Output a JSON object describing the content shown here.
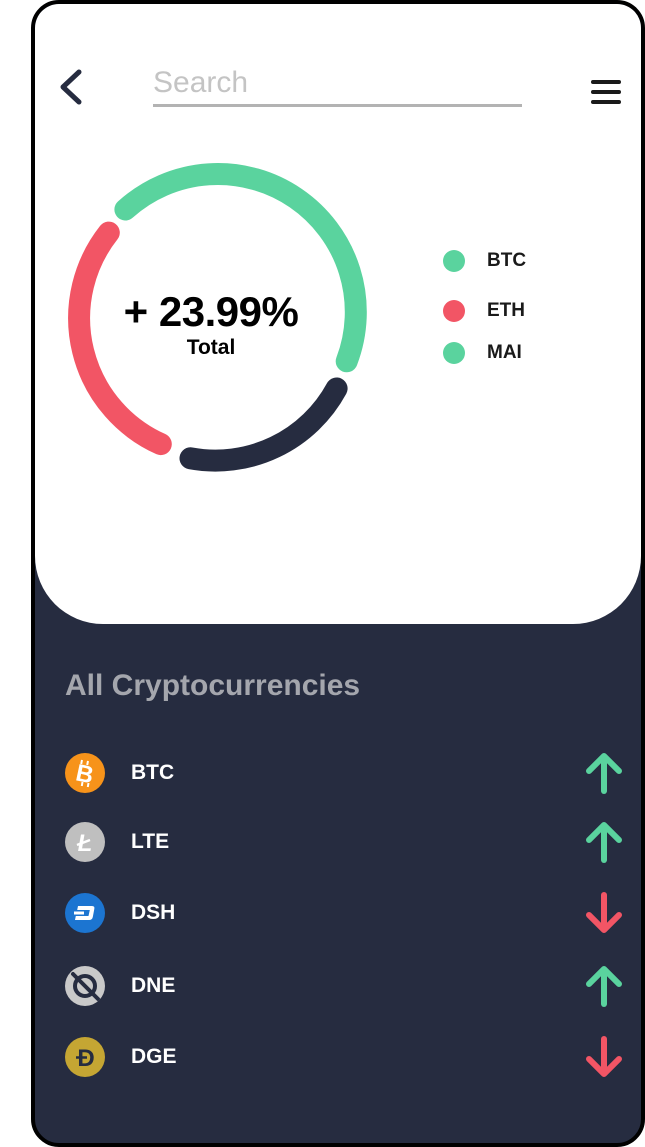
{
  "header": {
    "back_icon": "chevron-left-icon",
    "search_placeholder": "Search",
    "menu_icon": "hamburger-menu-icon"
  },
  "summary": {
    "change_value": "+ 23.99%",
    "change_label": "Total"
  },
  "chart_data": {
    "type": "donut",
    "segments": [
      {
        "name": "BTC",
        "color": "#5ad39e"
      },
      {
        "name": "MAI",
        "color": "#262c40"
      },
      {
        "name": "ETH",
        "color": "#f25565"
      }
    ],
    "legend": [
      {
        "label": "BTC",
        "color": "#5ad39e"
      },
      {
        "label": "ETH",
        "color": "#f25565"
      },
      {
        "label": "MAI",
        "color": "#5ad39e"
      }
    ]
  },
  "list": {
    "title": "All Cryptocurrencies",
    "items": [
      {
        "symbol": "BTC",
        "icon": "bitcoin-icon",
        "trend": "up"
      },
      {
        "symbol": "LTE",
        "icon": "litecoin-icon",
        "trend": "up"
      },
      {
        "symbol": "DSH",
        "icon": "dash-icon",
        "trend": "down"
      },
      {
        "symbol": "DNE",
        "icon": "dne-icon",
        "trend": "up"
      },
      {
        "symbol": "DGE",
        "icon": "dogecoin-icon",
        "trend": "down"
      }
    ]
  },
  "colors": {
    "up": "#5ad39e",
    "down": "#f25565",
    "background_dark": "#262c40",
    "muted_title": "#a4a6ad"
  }
}
